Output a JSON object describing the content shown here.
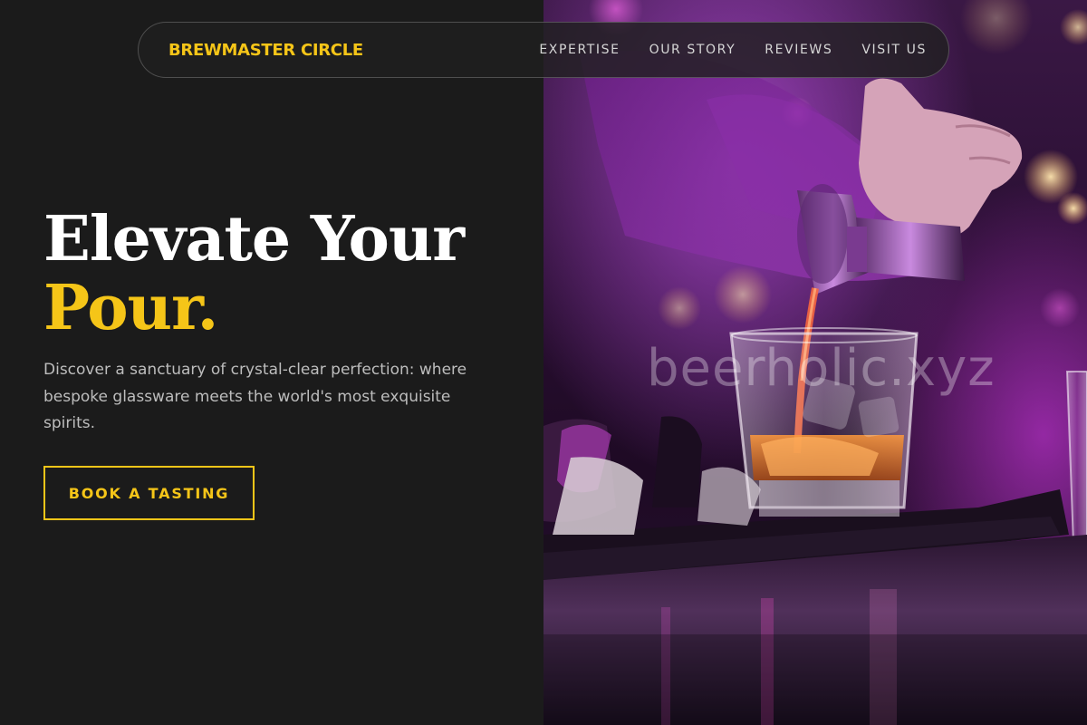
{
  "nav": {
    "brand": "BREWMASTER CIRCLE",
    "links": [
      "EXPERTISE",
      "OUR STORY",
      "REVIEWS",
      "VISIT US"
    ]
  },
  "hero": {
    "headline_line1": "Elevate Your",
    "headline_line2": "Pour.",
    "lede": "Discover a sanctuary of crystal-clear perfection: where bespoke glassware meets the world's most exquisite spirits.",
    "cta_label": "BOOK A TASTING"
  },
  "photo": {
    "watermark": "beerholic.xyz"
  },
  "colors": {
    "background": "#1b1b1b",
    "accent": "#f5c518",
    "text_primary": "#ffffff",
    "text_muted": "#bdbdbd"
  },
  "icons": {
    "photo_subject": "bartender-pouring-jigger-photo"
  }
}
